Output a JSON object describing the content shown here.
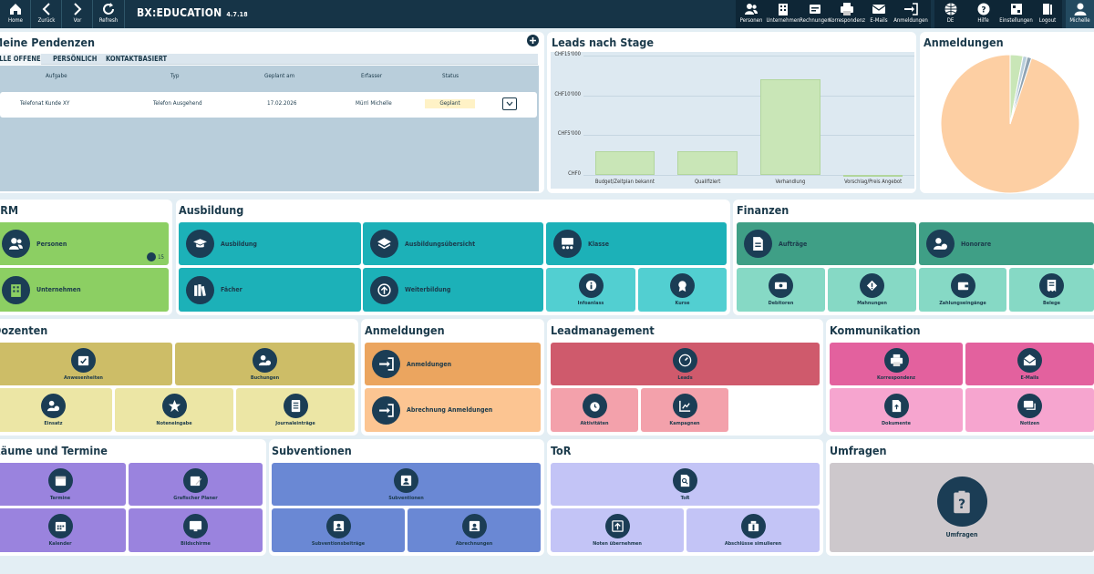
{
  "topbar": {
    "nav": [
      {
        "label": "Home",
        "icon": "home-icon"
      },
      {
        "label": "Zurück",
        "icon": "chevron-left-icon"
      },
      {
        "label": "Vor",
        "icon": "chevron-right-icon"
      },
      {
        "label": "Refresh",
        "icon": "refresh-icon"
      }
    ],
    "brand": "BX:EDUCATION",
    "version": "4.7.18",
    "menu": [
      {
        "label": "Personen",
        "icon": "people-icon"
      },
      {
        "label": "Unternehmen",
        "icon": "building-icon"
      },
      {
        "label": "Rechnungen",
        "icon": "invoice-icon"
      },
      {
        "label": "Korrespondenz",
        "icon": "printer-icon"
      },
      {
        "label": "E-Mails",
        "icon": "mail-icon"
      },
      {
        "label": "Anmeldungen",
        "icon": "signin-icon"
      },
      {
        "label": "DE",
        "icon": "globe-icon"
      },
      {
        "label": "Hilfe",
        "icon": "help-icon"
      },
      {
        "label": "Einstellungen",
        "icon": "settings-icon"
      },
      {
        "label": "Logout",
        "icon": "logout-icon"
      },
      {
        "label": "Michelle",
        "icon": "user-icon"
      }
    ]
  },
  "pendenzen": {
    "title": "Meine Pendenzen",
    "tabs": [
      "ALLE OFFENE",
      "PERSÖNLICH",
      "KONTAKTBASIERT"
    ],
    "columns": [
      "Aufgabe",
      "Typ",
      "Geplant am",
      "Erfasser",
      "Status"
    ],
    "rows": [
      {
        "aufgabe": "Telefonat Kunde XY",
        "typ": "Telefon Ausgehend",
        "geplant": "17.02.2026",
        "erfasser": "Mürri Michelle",
        "status": "Geplant"
      }
    ]
  },
  "leads_panel": {
    "title": "Leads nach Stage"
  },
  "chart_data": [
    {
      "type": "bar",
      "categories": [
        "Budget/Zeitplan bekannt",
        "Qualifiziert",
        "Verhandlung",
        "Vorschlag/Preis Angebot"
      ],
      "values": [
        3000,
        3000,
        12000,
        0
      ],
      "yticks": [
        "CHF0",
        "CHF5'000",
        "CHF10'000",
        "CHF15'000"
      ],
      "ylim": [
        0,
        15000
      ],
      "color": "#c9e6b7"
    },
    {
      "type": "pie",
      "title": "Anmeldungen",
      "values": [
        95,
        3,
        1,
        1
      ],
      "colors": [
        "#fdcfa3",
        "#c9e6b7",
        "#b9cedb",
        "#8fa3b3"
      ]
    }
  ],
  "crm": {
    "title": "CRM",
    "tiles": [
      {
        "label": "Personen",
        "icon": "people-icon",
        "badge": "15"
      },
      {
        "label": "Unternehmen",
        "icon": "building-icon"
      }
    ]
  },
  "ausbildung": {
    "title": "Ausbildung",
    "tiles": [
      {
        "label": "Ausbildung",
        "icon": "graduation-cap-icon"
      },
      {
        "label": "Ausbildungsübersicht",
        "icon": "layers-icon"
      },
      {
        "label": "Klasse",
        "icon": "classroom-icon"
      },
      {
        "label": "Fächer",
        "icon": "books-icon"
      },
      {
        "label": "Weiterbildung",
        "icon": "growth-icon"
      },
      {
        "label": "Infoanlass",
        "icon": "info-event-icon"
      },
      {
        "label": "Kurse",
        "icon": "certificate-icon"
      }
    ]
  },
  "finanzen": {
    "title": "Finanzen",
    "tiles": [
      {
        "label": "Aufträge",
        "icon": "order-icon"
      },
      {
        "label": "Honorare",
        "icon": "fee-icon"
      },
      {
        "label": "Debitoren",
        "icon": "debtor-icon"
      },
      {
        "label": "Mahnungen",
        "icon": "warning-icon"
      },
      {
        "label": "Zahlungseingänge",
        "icon": "wallet-icon"
      },
      {
        "label": "Belege",
        "icon": "receipt-icon"
      }
    ]
  },
  "dozenten": {
    "title": "Dozenten",
    "tiles": [
      {
        "label": "Anwesenheiten",
        "icon": "attendance-icon"
      },
      {
        "label": "Buchungen",
        "icon": "booking-icon"
      },
      {
        "label": "Einsatz",
        "icon": "deployment-icon"
      },
      {
        "label": "Noteneingabe",
        "icon": "star-icon"
      },
      {
        "label": "Journaleinträge",
        "icon": "journal-icon"
      }
    ]
  },
  "anmeldungen": {
    "title": "Anmeldungen",
    "tiles": [
      {
        "label": "Anmeldungen",
        "icon": "signin-icon"
      },
      {
        "label": "Abrechnung Anmeldungen",
        "icon": "signin-icon"
      }
    ]
  },
  "leadmanagement": {
    "title": "Leadmanagement",
    "tiles": [
      {
        "label": "Leads",
        "icon": "gauge-icon"
      },
      {
        "label": "Aktivitäten",
        "icon": "alarm-clock-icon"
      },
      {
        "label": "Kampagnen",
        "icon": "campaign-chart-icon"
      }
    ]
  },
  "kommunikation": {
    "title": "Kommunikation",
    "tiles": [
      {
        "label": "Korrespondenz",
        "icon": "printer-icon"
      },
      {
        "label": "E-Mails",
        "icon": "mail-open-icon"
      },
      {
        "label": "Dokumente",
        "icon": "document-icon"
      },
      {
        "label": "Notizen",
        "icon": "chat-icon"
      }
    ]
  },
  "raeume": {
    "title": "Räume und Termine",
    "tiles": [
      {
        "label": "Termine",
        "icon": "calendar-icon"
      },
      {
        "label": "Grafischer Planer",
        "icon": "calendar-edit-icon"
      },
      {
        "label": "Kalender",
        "icon": "calendar-grid-icon"
      },
      {
        "label": "Bildschirme",
        "icon": "monitor-icon"
      }
    ]
  },
  "subventionen": {
    "title": "Subventionen",
    "tiles": [
      {
        "label": "Subventionen",
        "icon": "subsidy-icon"
      },
      {
        "label": "Subventionsbeiträge",
        "icon": "subsidy-icon"
      },
      {
        "label": "Abrechnungen",
        "icon": "subsidy-icon"
      }
    ]
  },
  "tor": {
    "title": "ToR",
    "tiles": [
      {
        "label": "ToR",
        "icon": "tor-icon"
      },
      {
        "label": "Noten übernehmen",
        "icon": "upload-icon"
      },
      {
        "label": "Abschlüsse simulieren",
        "icon": "simulate-icon"
      }
    ]
  },
  "umfragen": {
    "title": "Umfragen",
    "tiles": [
      {
        "label": "Umfragen",
        "icon": "survey-icon"
      }
    ]
  }
}
